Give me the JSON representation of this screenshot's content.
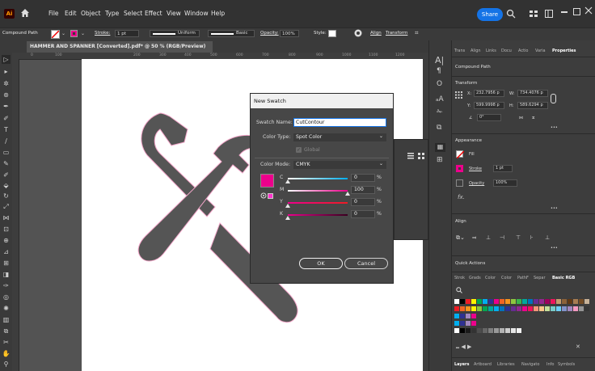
{
  "menubar": {
    "app_logo": "Ai",
    "items": [
      "File",
      "Edit",
      "Object",
      "Type",
      "Select",
      "Effect",
      "View",
      "Window",
      "Help"
    ],
    "share_label": "Share"
  },
  "controlbar": {
    "selection_label": "Compound Path",
    "stroke_label": "Stroke:",
    "stroke_value": "1 pt",
    "profile_uniform": "Uniform",
    "brush_basic": "Basic",
    "opacity_label": "Opacity:",
    "opacity_value": "100%",
    "style_label": "Style:",
    "align_label": "Align",
    "transform_label": "Transform"
  },
  "document": {
    "tab_title": "HAMMER AND SPANNER [Converted].pdf* @ 50 % (RGB/Preview)",
    "tab_close": "×",
    "ruler_labels": [
      "0",
      "100",
      "200",
      "300",
      "400",
      "500",
      "600",
      "700",
      "800",
      "900",
      "1000",
      "1100",
      "1200"
    ]
  },
  "dialog": {
    "title": "New Swatch",
    "swatch_name_label": "Swatch Name:",
    "swatch_name_value": "CutContour",
    "color_type_label": "Color Type:",
    "color_type_value": "Spot Color",
    "global_label": "Global",
    "color_mode_label": "Color Mode:",
    "color_mode_value": "CMYK",
    "channels": [
      {
        "label": "C",
        "value": "0",
        "unit": "%",
        "level": 0
      },
      {
        "label": "M",
        "value": "100",
        "unit": "%",
        "level": 1
      },
      {
        "label": "Y",
        "value": "0",
        "unit": "%",
        "level": 0
      },
      {
        "label": "K",
        "value": "0",
        "unit": "%",
        "level": 0
      }
    ],
    "ok_label": "OK",
    "cancel_label": "Cancel",
    "swatch_color": "#ec008c"
  },
  "properties": {
    "tabs": [
      "Trans",
      "Align",
      "Links",
      "Docu",
      "Actio",
      "Varia",
      "Properties"
    ],
    "active_tab": "Properties",
    "section_compound": "Compound Path",
    "section_transform": "Transform",
    "x_label": "X:",
    "x_value": "232.7956 p",
    "w_label": "W:",
    "w_value": "734.4076 p",
    "y_label": "Y:",
    "y_value": "599.9998 p",
    "h_label": "H:",
    "h_value": "589.6294 p",
    "angle_value": "0°",
    "section_appearance": "Appearance",
    "fill_label": "Fill",
    "stroke_label": "Stroke",
    "stroke_value": "1 pt",
    "opacity_label": "Opacity",
    "opacity_value": "100%",
    "fx_label": "fx.",
    "section_align": "Align",
    "section_quick": "Quick Actions",
    "swatch_tabs": [
      "Strok",
      "Grads",
      "Color",
      "Color",
      "PathF",
      "Separ",
      "Basic RGB"
    ],
    "bottom_tabs": [
      "Layers",
      "Artboard",
      "Libraries",
      "Navigato",
      "Info",
      "Symbols"
    ],
    "more": "•••"
  },
  "colors": {
    "accent_blue": "#1473e6",
    "magenta": "#ec008c",
    "dark_bg": "#323232"
  }
}
